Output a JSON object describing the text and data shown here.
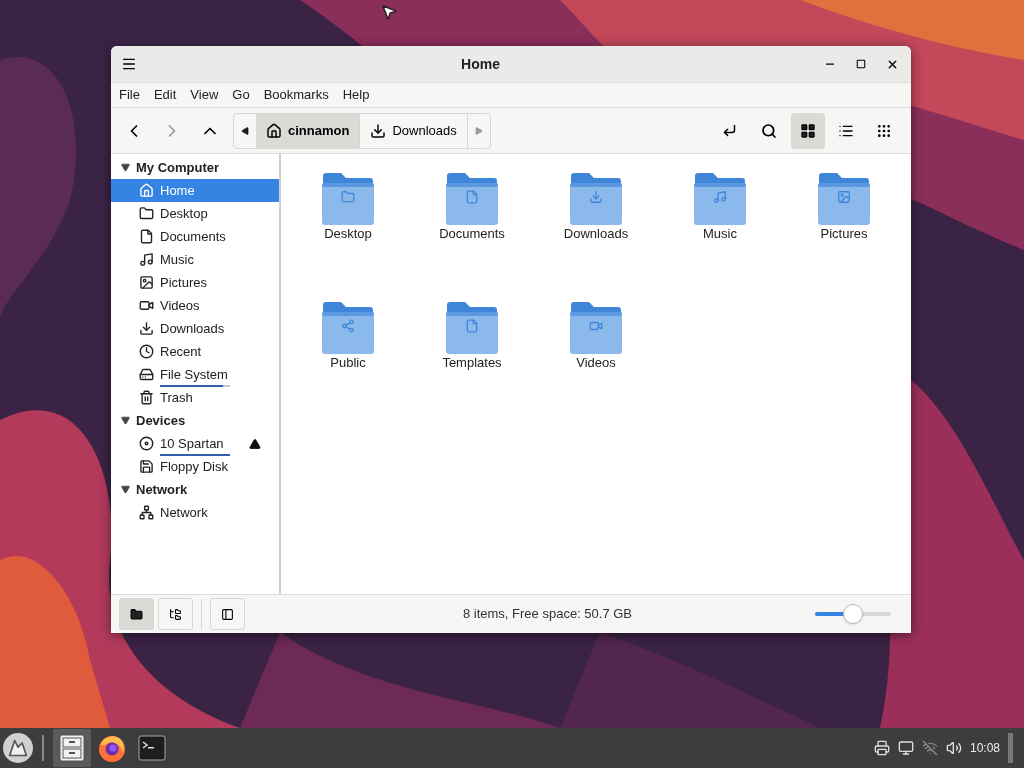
{
  "window": {
    "title": "Home"
  },
  "menu": [
    "File",
    "Edit",
    "View",
    "Go",
    "Bookmarks",
    "Help"
  ],
  "breadcrumb": [
    {
      "label": "cinnamon",
      "selected": true
    },
    {
      "label": "Downloads",
      "selected": false
    }
  ],
  "view_modes": [
    {
      "kind": "icons",
      "selected": true
    },
    {
      "kind": "list",
      "selected": false
    },
    {
      "kind": "compact",
      "selected": false
    }
  ],
  "sidebar": {
    "sections": [
      {
        "title": "My Computer",
        "expanded": true,
        "items": [
          {
            "label": "Home",
            "selected": true,
            "ejectable": false
          },
          {
            "label": "Desktop",
            "selected": false,
            "ejectable": false
          },
          {
            "label": "Documents",
            "selected": false,
            "ejectable": false
          },
          {
            "label": "Music",
            "selected": false,
            "ejectable": false
          },
          {
            "label": "Pictures",
            "selected": false,
            "ejectable": false
          },
          {
            "label": "Videos",
            "selected": false,
            "ejectable": false
          },
          {
            "label": "Downloads",
            "selected": false,
            "ejectable": false
          },
          {
            "label": "Recent",
            "selected": false,
            "ejectable": false
          },
          {
            "label": "File System",
            "selected": false,
            "ejectable": false,
            "level": 0.9
          },
          {
            "label": "Trash",
            "selected": false,
            "ejectable": false
          }
        ]
      },
      {
        "title": "Devices",
        "expanded": true,
        "items": [
          {
            "label": "10 Spartan",
            "selected": false,
            "ejectable": true,
            "level": 1
          },
          {
            "label": "Floppy Disk",
            "selected": false,
            "ejectable": false
          }
        ]
      },
      {
        "title": "Network",
        "expanded": true,
        "items": [
          {
            "label": "Network",
            "selected": false,
            "ejectable": false
          }
        ]
      }
    ]
  },
  "files": [
    {
      "name": "Desktop"
    },
    {
      "name": "Documents"
    },
    {
      "name": "Downloads"
    },
    {
      "name": "Music"
    },
    {
      "name": "Pictures"
    },
    {
      "name": "Public"
    },
    {
      "name": "Templates"
    },
    {
      "name": "Videos"
    }
  ],
  "status_bar": {
    "panes": [
      {
        "kind": "places",
        "selected": true
      },
      {
        "kind": "tree",
        "selected": false
      }
    ],
    "text": "8 items, Free space: 50.7 GB",
    "zoom": {
      "level": 0.5
    }
  },
  "taskbar": {
    "apps": [
      {
        "kind": "files",
        "selected": true
      },
      {
        "kind": "firefox",
        "selected": false
      },
      {
        "kind": "terminal",
        "selected": false
      }
    ],
    "clock": "10:08"
  }
}
